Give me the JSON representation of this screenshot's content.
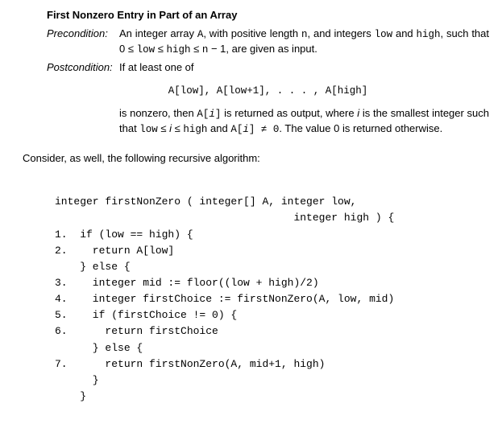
{
  "heading": "First Nonzero Entry in Part of an Array",
  "precondition": {
    "label": "Precondition:",
    "body": "An integer array A, with positive length n, and integers low and high, such that 0 ≤ low ≤ high ≤ n − 1, are given as input."
  },
  "postcondition": {
    "label": "Postcondition:",
    "lead": "If at least one of",
    "math": "A[low], A[low+1], . . . , A[high]",
    "tail_before_ai": "is nonzero, then ",
    "tail_ai": "A[i]",
    "tail_mid1": " is returned as output, where i is the smallest integer such that ",
    "tail_cond": "low ≤ i ≤ high",
    "tail_mid2": " and ",
    "tail_ai2": "A[i] ≠ 0",
    "tail_end": ". The value 0 is returned otherwise."
  },
  "consider": "Consider, as well, the following recursive algorithm:",
  "code": {
    "sig1": "integer firstNonZero ( integer[] A, integer low,",
    "sig2": "                                      integer high ) {",
    "l1": "1.  if (low == high) {",
    "l2": "2.    return A[low]",
    "le1": "    } else {",
    "l3": "3.    integer mid := floor((low + high)/2)",
    "l4": "4.    integer firstChoice := firstNonZero(A, low, mid)",
    "l5": "5.    if (firstChoice != 0) {",
    "l6": "6.      return firstChoice",
    "le2": "      } else {",
    "l7": "7.      return firstNonZero(A, mid+1, high)",
    "le3": "      }",
    "le4": "    }"
  }
}
